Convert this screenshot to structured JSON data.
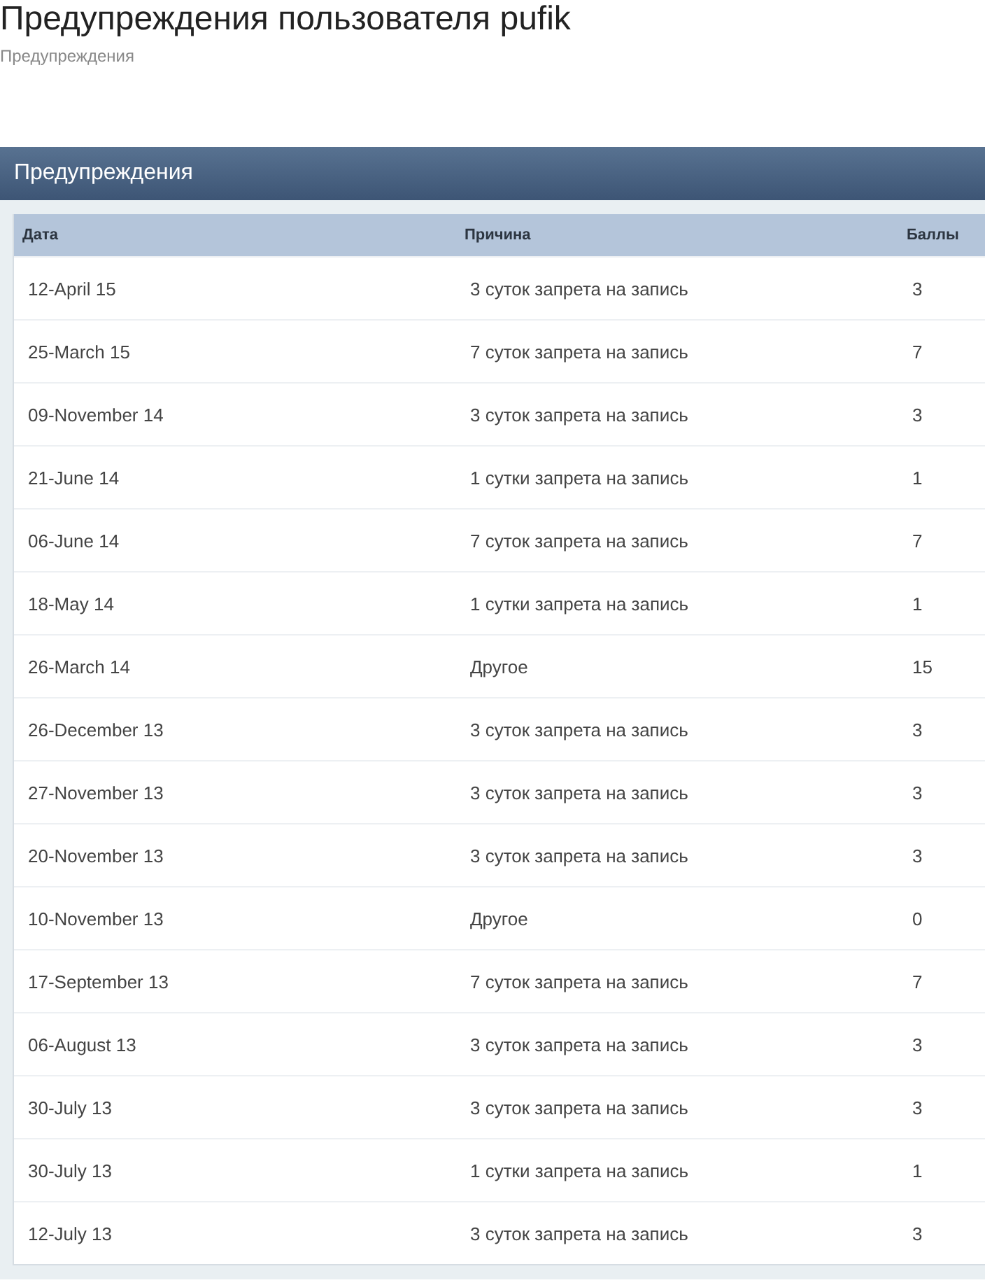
{
  "page": {
    "title": "Предупреждения пользователя pufik",
    "breadcrumb": "Предупреждения"
  },
  "panel": {
    "title": "Предупреждения"
  },
  "table": {
    "columns": [
      "Дата",
      "Причина",
      "Баллы"
    ],
    "rows": [
      [
        "12-April 15",
        "3 суток запрета на запись",
        "3"
      ],
      [
        "25-March 15",
        "7 суток запрета на запись",
        "7"
      ],
      [
        "09-November 14",
        "3 суток запрета на запись",
        "3"
      ],
      [
        "21-June 14",
        "1 сутки запрета на запись",
        "1"
      ],
      [
        "06-June 14",
        "7 суток запрета на запись",
        "7"
      ],
      [
        "18-May 14",
        "1 сутки запрета на запись",
        "1"
      ],
      [
        "26-March 14",
        "Другое",
        "15"
      ],
      [
        "26-December 13",
        "3 суток запрета на запись",
        "3"
      ],
      [
        "27-November 13",
        "3 суток запрета на запись",
        "3"
      ],
      [
        "20-November 13",
        "3 суток запрета на запись",
        "3"
      ],
      [
        "10-November 13",
        "Другое",
        "0"
      ],
      [
        "17-September 13",
        "7 суток запрета на запись",
        "7"
      ],
      [
        "06-August 13",
        "3 суток запрета на запись",
        "3"
      ],
      [
        "30-July 13",
        "3 суток запрета на запись",
        "3"
      ],
      [
        "30-July 13",
        "1 сутки запрета на запись",
        "1"
      ],
      [
        "12-July 13",
        "3 суток запрета на запись",
        "3"
      ]
    ]
  }
}
